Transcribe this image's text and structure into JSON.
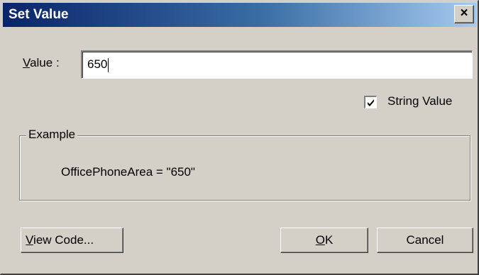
{
  "dialog": {
    "title": "Set Value",
    "close_glyph": "×"
  },
  "value_field": {
    "label_mnemonic": "V",
    "label_rest": "alue :",
    "value": "650"
  },
  "string_value": {
    "label": "String Value",
    "checked": true
  },
  "example": {
    "legend": "Example",
    "text": "OfficePhoneArea = \"650\""
  },
  "buttons": {
    "view_code_mnemonic": "V",
    "view_code_rest": "iew Code...",
    "ok_mnemonic": "O",
    "ok_rest": "K",
    "cancel": "Cancel"
  },
  "colors": {
    "face": "#d4d0c8",
    "title_gradient_start": "#0a246a",
    "title_gradient_end": "#a6caf0"
  },
  "icons": [
    "close-icon",
    "checkmark-icon"
  ]
}
